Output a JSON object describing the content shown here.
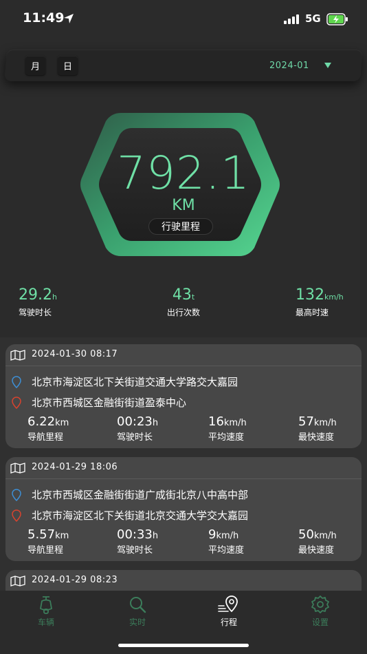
{
  "status_bar": {
    "time": "11:49",
    "network": "5G"
  },
  "filter": {
    "month_label": "月",
    "day_label": "日",
    "selected_period": "2024-01"
  },
  "summary": {
    "distance_value": "792.1",
    "distance_unit": "KM",
    "distance_label": "行驶里程",
    "stats": [
      {
        "value": "29.2",
        "unit": "h",
        "label": "驾驶时长"
      },
      {
        "value": "43",
        "unit": "t",
        "label": "出行次数"
      },
      {
        "value": "132",
        "unit": "km/h",
        "label": "最高时速"
      }
    ]
  },
  "trips": [
    {
      "datetime": "2024-01-30 08:17",
      "start": "北京市海淀区北下关街道交通大学路交大嘉园",
      "end": "北京市西城区金融街街道盈泰中心",
      "metrics": [
        {
          "value": "6.22",
          "unit": "km",
          "label": "导航里程"
        },
        {
          "value": "00:23",
          "unit": "h",
          "label": "驾驶时长"
        },
        {
          "value": "16",
          "unit": "km/h",
          "label": "平均速度"
        },
        {
          "value": "57",
          "unit": "km/h",
          "label": "最快速度"
        }
      ]
    },
    {
      "datetime": "2024-01-29 18:06",
      "start": "北京市西城区金融街街道广成街北京八中高中部",
      "end": "北京市海淀区北下关街道北京交通大学交大嘉园",
      "metrics": [
        {
          "value": "5.57",
          "unit": "km",
          "label": "导航里程"
        },
        {
          "value": "00:33",
          "unit": "h",
          "label": "驾驶时长"
        },
        {
          "value": "9",
          "unit": "km/h",
          "label": "平均速度"
        },
        {
          "value": "50",
          "unit": "km/h",
          "label": "最快速度"
        }
      ]
    },
    {
      "datetime": "2024-01-29 08:23"
    }
  ],
  "tabs": [
    {
      "label": "车辆",
      "icon": "scooter-icon"
    },
    {
      "label": "实时",
      "icon": "search-icon"
    },
    {
      "label": "行程",
      "icon": "route-pin-icon"
    },
    {
      "label": "设置",
      "icon": "gear-icon"
    }
  ],
  "colors": {
    "accent": "#6fe0a6",
    "tab_inactive": "#3c7d5b",
    "start_pin": "#3d8fd6",
    "end_pin": "#d9432e"
  }
}
